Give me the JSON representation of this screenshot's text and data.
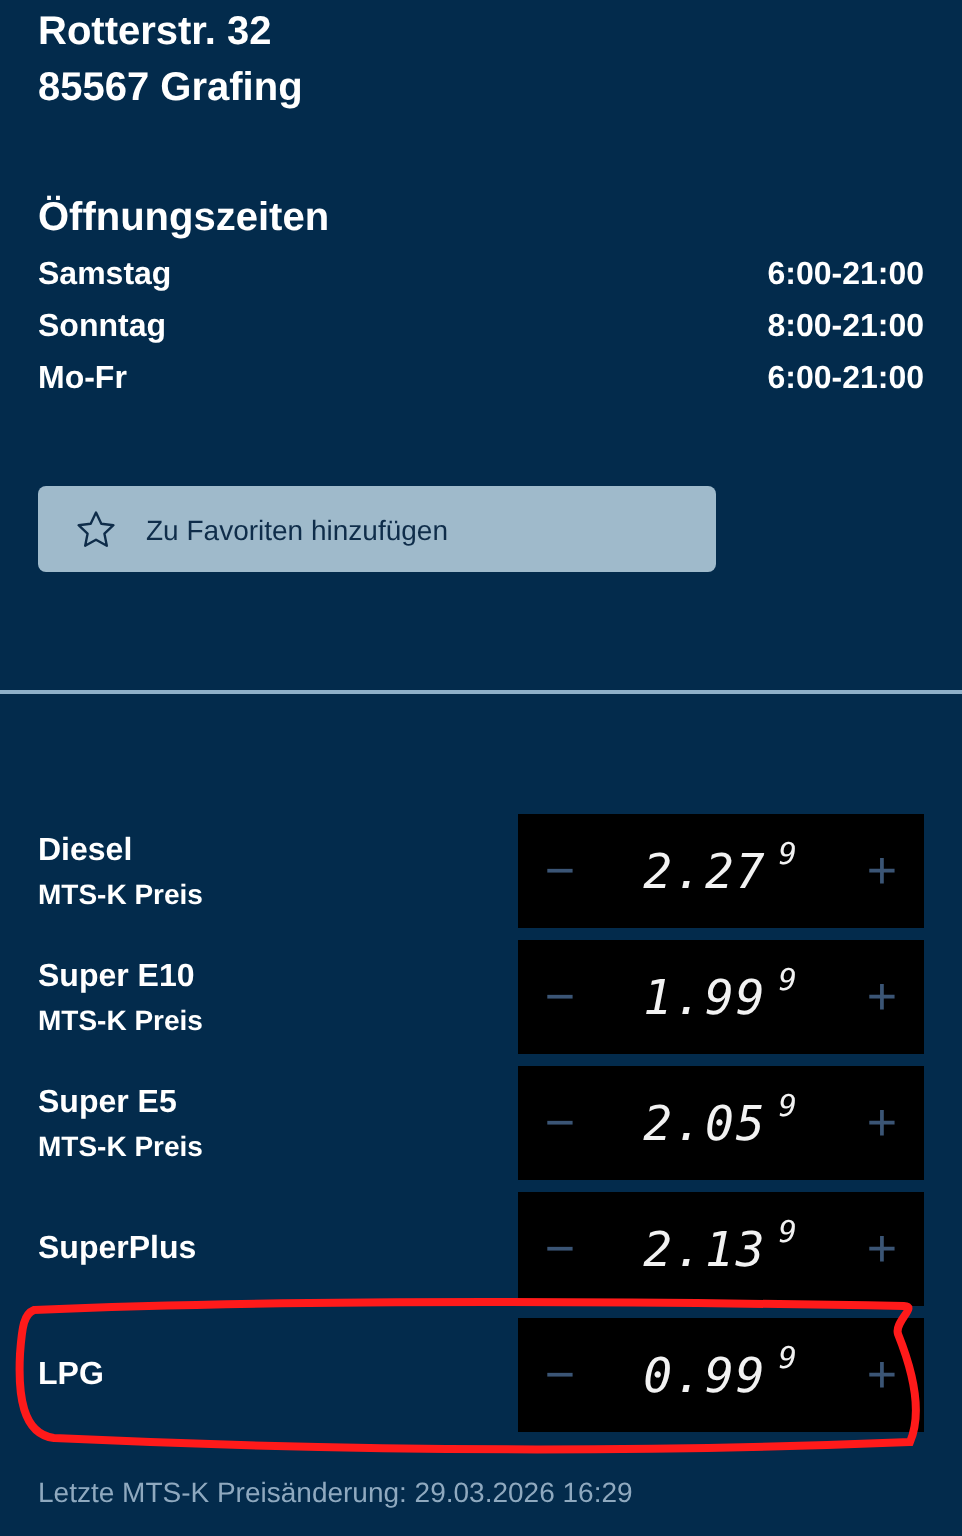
{
  "address": [
    "Rotterstr. 32",
    "85567 Grafing"
  ],
  "opening_hours": {
    "title": "Öffnungszeiten",
    "rows": [
      {
        "day": "Samstag",
        "time": "6:00-21:00"
      },
      {
        "day": "Sonntag",
        "time": "8:00-21:00"
      },
      {
        "day": "Mo-Fr",
        "time": "6:00-21:00"
      }
    ]
  },
  "favorite_button": {
    "label": "Zu Favoriten hinzufügen"
  },
  "fuels": [
    {
      "name": "Diesel",
      "source": "MTS-K Preis",
      "price": "2.27",
      "price_tenth": "9",
      "minus": "−",
      "plus": "+",
      "highlighted": false
    },
    {
      "name": "Super E10",
      "source": "MTS-K Preis",
      "price": "1.99",
      "price_tenth": "9",
      "minus": "−",
      "plus": "+",
      "highlighted": false
    },
    {
      "name": "Super E5",
      "source": "MTS-K Preis",
      "price": "2.05",
      "price_tenth": "9",
      "minus": "−",
      "plus": "+",
      "highlighted": false
    },
    {
      "name": "SuperPlus",
      "price": "2.13",
      "price_tenth": "9",
      "minus": "−",
      "plus": "+",
      "highlighted": false
    },
    {
      "name": "LPG",
      "price": "0.99",
      "price_tenth": "9",
      "minus": "−",
      "plus": "+",
      "highlighted": true
    }
  ],
  "footer": "Letzte MTS-K Preisänderung: 29.03.2026 16:29"
}
